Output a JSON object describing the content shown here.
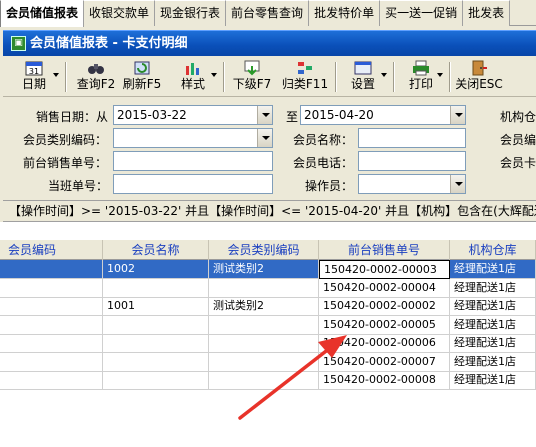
{
  "tabs": [
    "会员储值报表",
    "收银交款单",
    "现金银行表",
    "前台零售查询",
    "批发特价单",
    "买一送一促销",
    "批发表"
  ],
  "window": {
    "icon": "report-app-icon",
    "title": "会员储值报表 - 卡支付明细"
  },
  "toolbar": [
    {
      "label": "日期",
      "icon": "calendar-icon",
      "dropdown": true
    },
    {
      "label": "查询F2",
      "icon": "binoculars-icon",
      "dropdown": false
    },
    {
      "label": "刷新F5",
      "icon": "refresh-icon",
      "dropdown": false
    },
    {
      "label": "样式",
      "icon": "chart-style-icon",
      "dropdown": true
    },
    {
      "label": "下级F7",
      "icon": "drill-down-icon",
      "dropdown": false
    },
    {
      "label": "归类F11",
      "icon": "group-icon",
      "dropdown": false
    },
    {
      "label": "设置",
      "icon": "settings-icon",
      "dropdown": true
    },
    {
      "label": "打印",
      "icon": "printer-icon",
      "dropdown": true
    },
    {
      "label": "关闭ESC",
      "icon": "close-door-icon",
      "dropdown": false
    }
  ],
  "form": {
    "sale_date_label": "销售日期：从",
    "date_from": "2015-03-22",
    "to_label": "至",
    "date_to": "2015-04-20",
    "org_label": "机构仓",
    "member_type_label": "会员类别编码：",
    "member_name_label": "会员名称：",
    "member_code_label": "会员编",
    "receipt_no_label": "前台销售单号：",
    "phone_label": "会员电话：",
    "card_label": "会员卡",
    "shift_label": "当班单号：",
    "operator_label": "操作员："
  },
  "filter_text": "【操作时间】>= '2015-03-22' 并且【操作时间】<= '2015-04-20' 并且【机构】包含在(大辉配送",
  "grid": {
    "columns": [
      "会员编码",
      "会员名称",
      "会员类别编码",
      "前台销售单号",
      "机构仓库"
    ],
    "rows": [
      {
        "code": "",
        "name": "1002",
        "type": "测试类别2",
        "receipt": "150420-0002-00003",
        "store": "经理配送1店",
        "selected": true
      },
      {
        "code": "",
        "name": "",
        "type": "",
        "receipt": "150420-0002-00004",
        "store": "经理配送1店",
        "selected": false
      },
      {
        "code": "",
        "name": "1001",
        "type": "测试类别2",
        "receipt": "150420-0002-00002",
        "store": "经理配送1店",
        "selected": false
      },
      {
        "code": "",
        "name": "",
        "type": "",
        "receipt": "150420-0002-00005",
        "store": "经理配送1店",
        "selected": false
      },
      {
        "code": "",
        "name": "",
        "type": "",
        "receipt": "150420-0002-00006",
        "store": "经理配送1店",
        "selected": false
      },
      {
        "code": "",
        "name": "",
        "type": "",
        "receipt": "150420-0002-00007",
        "store": "经理配送1店",
        "selected": false
      },
      {
        "code": "",
        "name": "",
        "type": "",
        "receipt": "150420-0002-00008",
        "store": "经理配送1店",
        "selected": false
      }
    ]
  },
  "annotation_color": "#e8332a"
}
